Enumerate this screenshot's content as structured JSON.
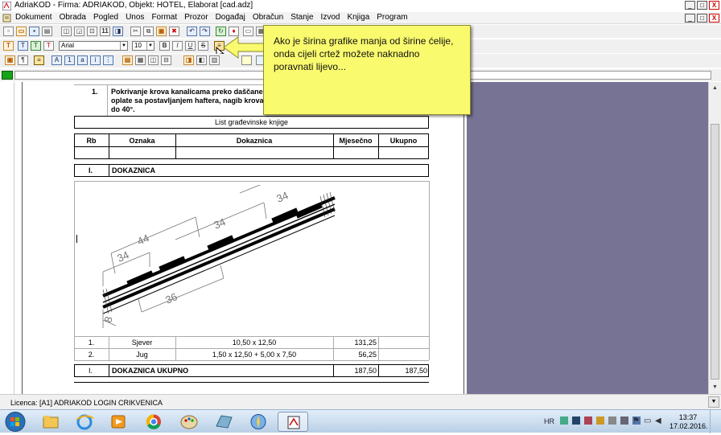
{
  "window": {
    "title": "AdriaKOD - Firma: ADRIAKOD,   Objekt: HOTEL, Elaborat [cad.adz]",
    "minimize": "_",
    "maximize": "□",
    "close": "X"
  },
  "menu": {
    "items": [
      "Dokument",
      "Obrada",
      "Pogled",
      "Unos",
      "Format",
      "Prozor",
      "Događaj",
      "Obračun",
      "Stanje",
      "Izvod",
      "Knjiga",
      "Program"
    ]
  },
  "toolbar": {
    "font": "Arial",
    "size": "10",
    "bold": "B",
    "italic": "I",
    "underline": "U",
    "strike": "S",
    "text_t": "T",
    "num11": "11"
  },
  "tooltip": {
    "text": "Ako je širina grafike manja od širine ćelije, onda cijeli crtež možete naknadno poravnati lijevo..."
  },
  "document": {
    "item_no": "1.",
    "item_desc_lines": [
      "Pokrivanje krova kanalicama preko daščane",
      "oplate sa postavljanjem haftera, nagib krova",
      "do 40°."
    ],
    "list_title": "List građevinske knjige",
    "headers": {
      "rb": "Rb",
      "oznaka": "Oznaka",
      "dokaznica": "Dokaznica",
      "mjesecno": "Mjesečno",
      "ukupno": "Ukupno"
    },
    "section": {
      "rb": "I.",
      "name": "DOKAZNICA"
    },
    "drawing_dims": [
      "34",
      "44",
      "34",
      "34",
      "36",
      "8"
    ],
    "rows": [
      {
        "rb": "1.",
        "oznaka": "Sjever",
        "dokaznica": "10,50 x 12,50",
        "mjesecno": "131,25",
        "ukupno": ""
      },
      {
        "rb": "2.",
        "oznaka": "Jug",
        "dokaznica": "1,50 x 12,50 + 5,00 x 7,50",
        "mjesecno": "56,25",
        "ukupno": ""
      }
    ],
    "total": {
      "rb": "I.",
      "name": "DOKAZNICA UKUPNO",
      "mjesecno": "187,50",
      "ukupno": "187,50"
    }
  },
  "status": {
    "license": "Licenca: [A1] ADRIAKOD LOGIN CRIKVENICA"
  },
  "taskbar": {
    "lang": "HR",
    "time": "13:37",
    "date": "17.02.2016."
  },
  "colors": {
    "tooltip_bg": "#fafa6e",
    "workspace_bg": "#777395",
    "status_green": "#17a317"
  }
}
